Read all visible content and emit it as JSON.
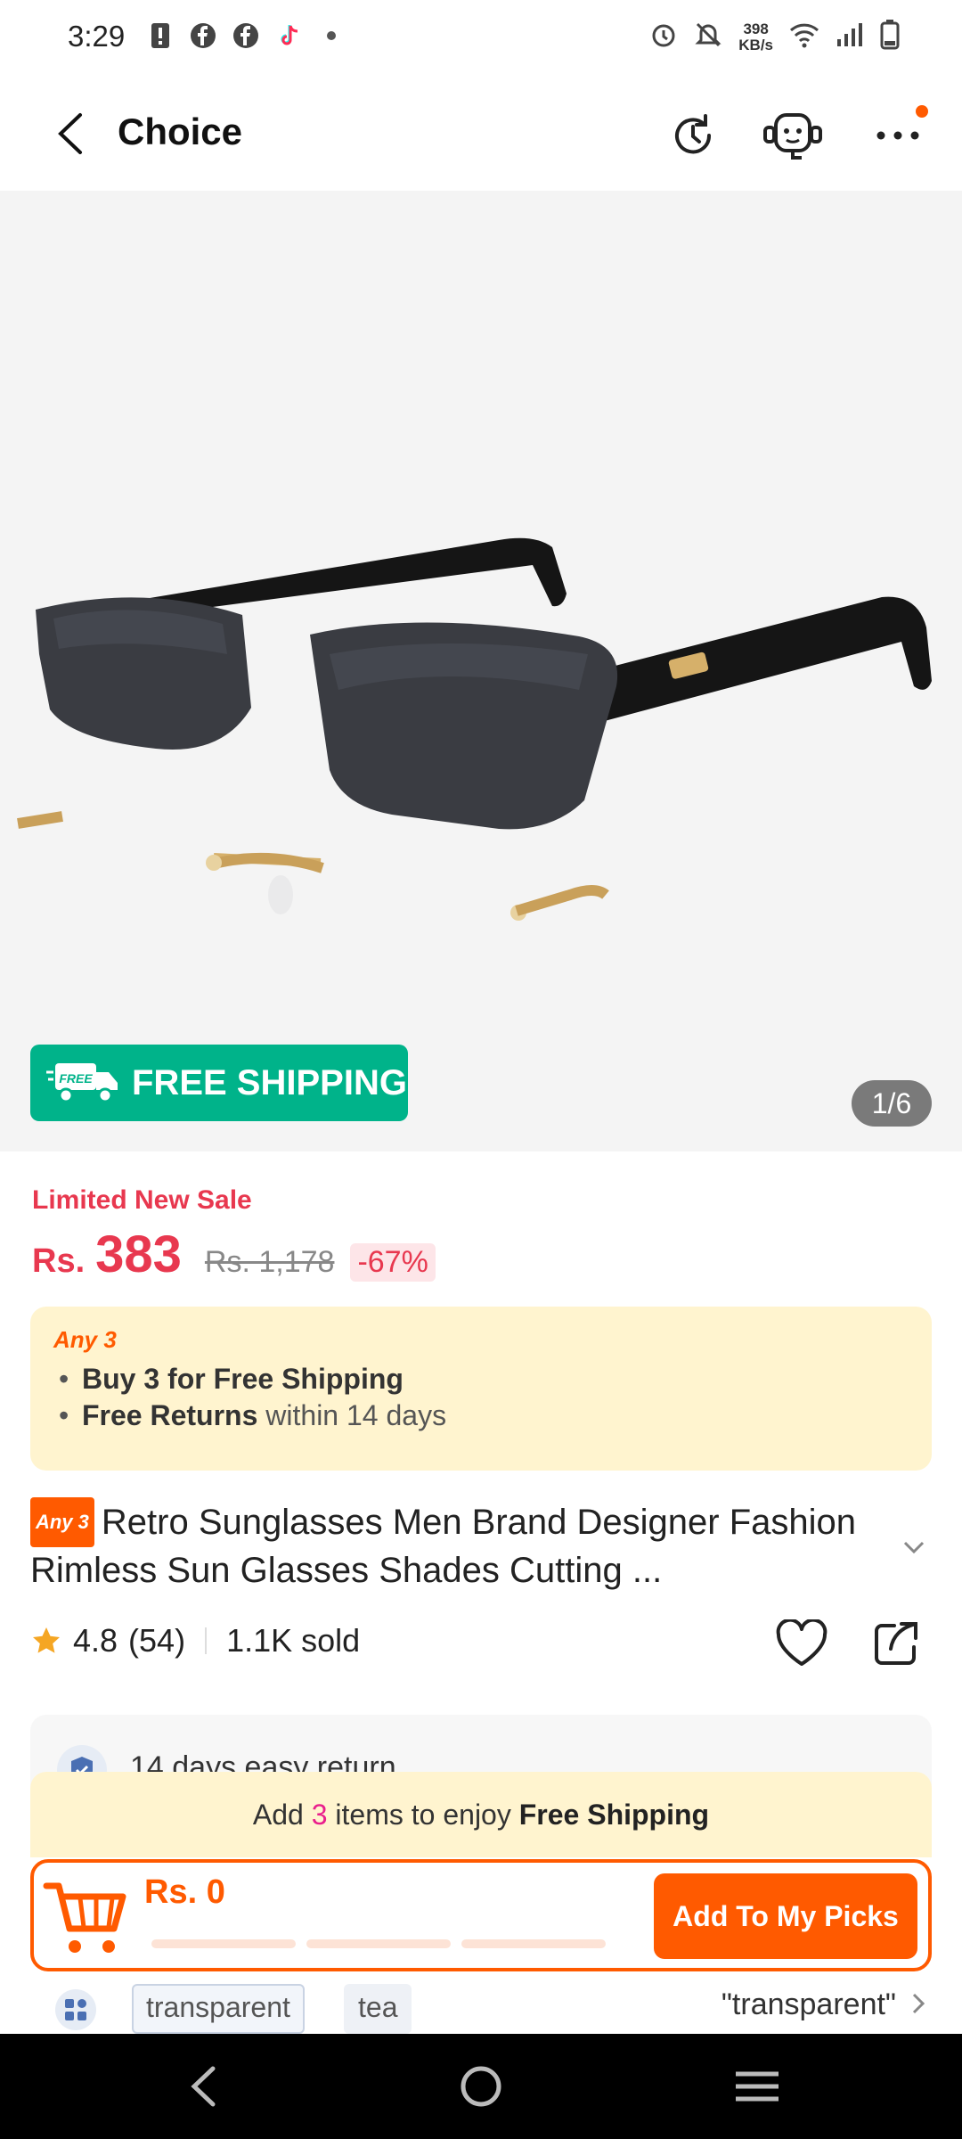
{
  "status_bar": {
    "time": "3:29",
    "net_speed_value": "398",
    "net_speed_unit": "KB/s",
    "left_icons": [
      "alert-icon",
      "facebook-icon",
      "facebook-icon",
      "tiktok-icon",
      "dot-icon"
    ],
    "right_icons": [
      "alarm-icon",
      "mute-icon",
      "wifi-icon",
      "signal-icon",
      "battery-icon"
    ]
  },
  "header": {
    "title": "Choice",
    "icons": [
      "back-arrow-icon",
      "history-icon",
      "support-agent-icon",
      "more-icon"
    ],
    "badge_color": "#ff5a00"
  },
  "gallery": {
    "free_shipping_label": "FREE SHIPPING",
    "free_badge_text": "FREE",
    "counter": "1/6"
  },
  "price": {
    "sale_label": "Limited New Sale",
    "currency": "Rs.",
    "amount": "383",
    "original": "Rs. 1,178",
    "discount": "-67%"
  },
  "promo": {
    "tag": "Any 3",
    "line1_bold": "Buy 3 for  Free Shipping",
    "line2_bold": "Free Returns",
    "line2_rest": " within 14 days"
  },
  "product": {
    "tag": "Any 3",
    "title": "Retro Sunglasses Men Brand Designer Fashion Rimless Sun Glasses Shades Cutting ..."
  },
  "rating": {
    "score": "4.8",
    "count": "(54)",
    "sold": "1.1K sold"
  },
  "service": {
    "return_text": "14 days easy return"
  },
  "cart_panel": {
    "prefix": "Add ",
    "count": "3",
    "middle": " items to enjoy ",
    "bold": "Free Shipping",
    "total": "Rs. 0",
    "button_label": "Add To My Picks",
    "progress": [
      0,
      0,
      0
    ]
  },
  "keywords": {
    "chips": [
      "transparent",
      "tea"
    ],
    "selected": "\"transparent\""
  },
  "colors": {
    "accent": "#ff5a00",
    "price_red": "#e8384f",
    "free_ship_green": "#00b38a",
    "promo_bg": "#fff4cf"
  }
}
